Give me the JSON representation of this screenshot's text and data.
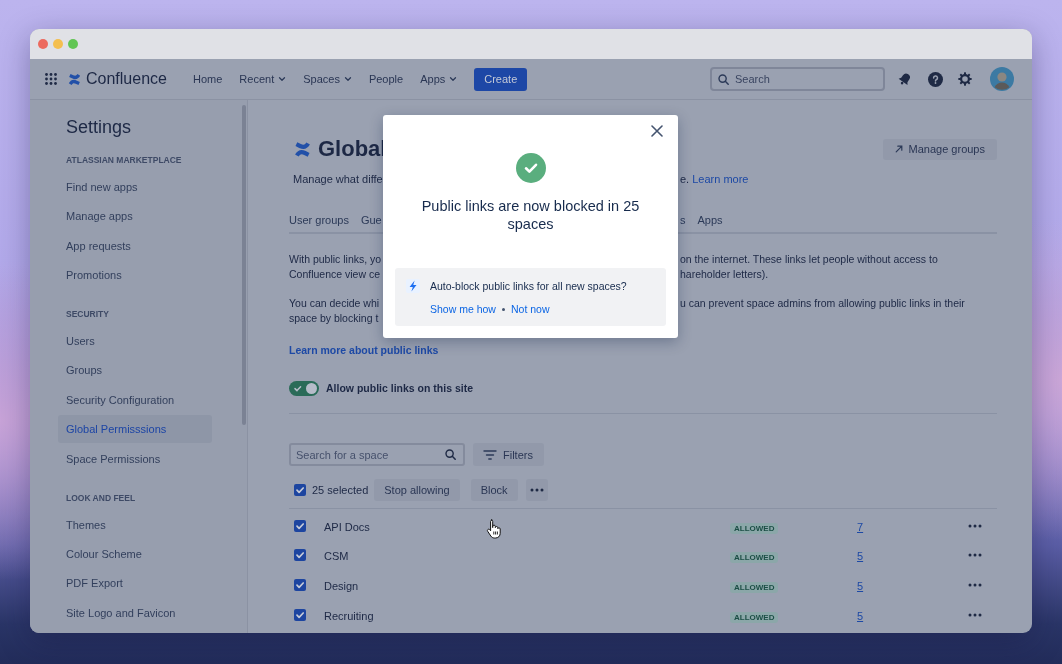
{
  "navbar": {
    "product": "Confluence",
    "items": [
      {
        "label": "Home",
        "dropdown": false
      },
      {
        "label": "Recent",
        "dropdown": true
      },
      {
        "label": "Spaces",
        "dropdown": true
      },
      {
        "label": "People",
        "dropdown": false
      },
      {
        "label": "Apps",
        "dropdown": true
      }
    ],
    "create_button": "Create",
    "search": {
      "placeholder": "Search"
    }
  },
  "sidebar": {
    "title": "Settings",
    "sections": [
      {
        "heading": "ATLASSIAN MARKETPLACE",
        "items": [
          {
            "label": "Find new apps",
            "selected": false
          },
          {
            "label": "Manage apps",
            "selected": false
          },
          {
            "label": "App requests",
            "selected": false
          },
          {
            "label": "Promotions",
            "selected": false
          }
        ]
      },
      {
        "heading": "SECURITY",
        "items": [
          {
            "label": "Users",
            "selected": false
          },
          {
            "label": "Groups",
            "selected": false
          },
          {
            "label": "Security Configuration",
            "selected": false
          },
          {
            "label": "Global Permisssions",
            "selected": true
          },
          {
            "label": "Space Permissions",
            "selected": false
          }
        ]
      },
      {
        "heading": "LOOK AND FEEL",
        "items": [
          {
            "label": "Themes",
            "selected": false
          },
          {
            "label": "Colour Scheme",
            "selected": false
          },
          {
            "label": "PDF Export",
            "selected": false
          },
          {
            "label": "Site Logo and Favicon",
            "selected": false
          }
        ]
      }
    ]
  },
  "page": {
    "title": "Global",
    "manage_groups_button": "Manage groups",
    "description": {
      "left": "Manage what diffe",
      "right": "e.",
      "link": "Learn more"
    },
    "tabs": {
      "left": [
        {
          "label": "User groups",
          "selected": false
        },
        {
          "label": "Gue",
          "selected": false
        }
      ],
      "right": [
        {
          "label": "s",
          "selected": false
        },
        {
          "label": "Apps",
          "selected": false
        }
      ]
    },
    "paragraphs": [
      {
        "left_lines": [
          "With public links, yo",
          "Confluence view ce"
        ],
        "right_lines": [
          "on the internet. These links let people without access to",
          "hareholder letters)."
        ]
      },
      {
        "left_lines": [
          "You can decide whi",
          "space by blocking t"
        ],
        "right_lines": [
          "u can prevent space admins from allowing public links in their"
        ]
      }
    ],
    "learn_more_link": "Learn more about public links",
    "public_links_toggle": {
      "label": "Allow public links on this site",
      "on": true
    },
    "space_search": {
      "placeholder": "Search for a space"
    },
    "filters_button": "Filters",
    "bulk_actions": {
      "checked": true,
      "label": "25 selected",
      "actions": [
        "Stop allowing",
        "Block"
      ]
    },
    "spaces": [
      {
        "name": "API Docs",
        "checked": true,
        "status": "ALLOWED",
        "count": "7"
      },
      {
        "name": "CSM",
        "checked": true,
        "status": "ALLOWED",
        "count": "5"
      },
      {
        "name": "Design",
        "checked": true,
        "status": "ALLOWED",
        "count": "5"
      },
      {
        "name": "Recruiting",
        "checked": true,
        "status": "ALLOWED",
        "count": "5"
      }
    ]
  },
  "dialog": {
    "title": "Public links are now blocked in 25 spaces",
    "prompt": "Auto-block public links for all new spaces?",
    "links": [
      "Show me how",
      "Not now"
    ]
  }
}
